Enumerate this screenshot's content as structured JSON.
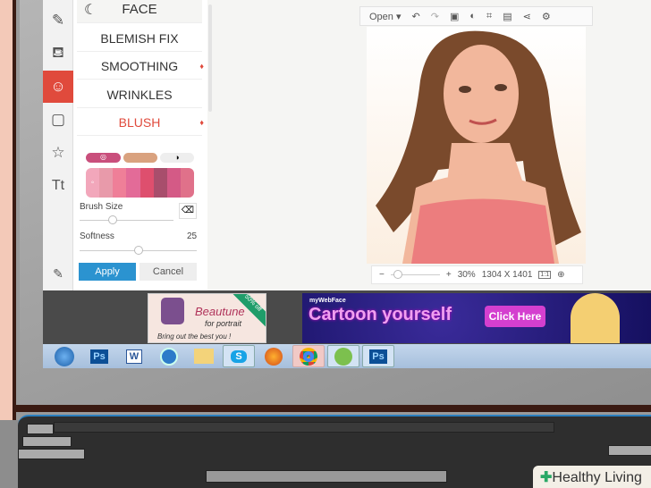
{
  "toolbar": {
    "open_label": "Open",
    "icons": [
      "undo-icon",
      "redo-icon",
      "image-icon",
      "contrast-icon",
      "crop-screen-icon",
      "save-icon",
      "share-icon",
      "settings-icon"
    ]
  },
  "panel": {
    "header": "FACE",
    "items": [
      {
        "label": "BLEMISH FIX",
        "premium": false
      },
      {
        "label": "SMOOTHING",
        "premium": true
      },
      {
        "label": "WRINKLES",
        "premium": false
      },
      {
        "label": "BLUSH",
        "premium": true,
        "active": true
      }
    ],
    "swatches": [
      "#f2a7bb",
      "#e89aaa",
      "#ef7f98",
      "#e36b98",
      "#de4f6e",
      "#a84e6c",
      "#d45a86",
      "#e0718a"
    ],
    "mode_colors": [
      "#c94f7c",
      "#d9a27f",
      "#eeeeee"
    ],
    "brush_size_label": "Brush Size",
    "brush_size_fraction": 0.3,
    "softness_label": "Softness",
    "softness_value": "25",
    "softness_fraction": 0.5,
    "apply_label": "Apply",
    "cancel_label": "Cancel"
  },
  "zoom": {
    "minus": "−",
    "plus": "+",
    "percent": "30%",
    "dimensions": "1304 X 1401",
    "actual_size": "1:1",
    "zoom_fraction": 0.05
  },
  "ads": {
    "beautune": {
      "title": "Beautune",
      "subtitle": "for portrait",
      "tagline": "Bring out the best you !",
      "badge": "50% off"
    },
    "mywebface": {
      "brand": "myWebFace",
      "headline": "Cartoon yourself",
      "cta": "Click Here"
    }
  },
  "taskbar": [
    "start",
    "Ps",
    "W",
    "itunes",
    "explorer",
    "S",
    "firefox",
    "chrome",
    "app",
    "Ps"
  ],
  "watermark": "Healthy Living"
}
